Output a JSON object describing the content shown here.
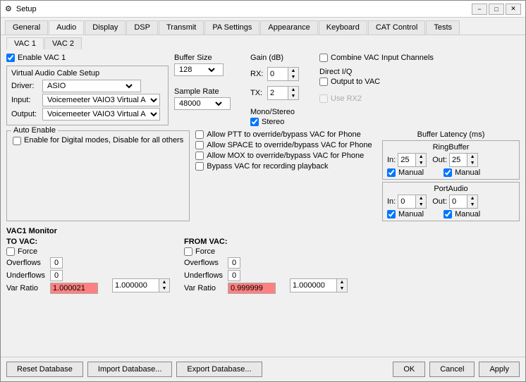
{
  "window": {
    "title": "Setup",
    "icon": "gear-icon"
  },
  "title_bar_controls": {
    "minimize": "−",
    "maximize": "□",
    "close": "✕"
  },
  "tabs_main": [
    {
      "label": "General",
      "active": false
    },
    {
      "label": "Audio",
      "active": true
    },
    {
      "label": "Display",
      "active": false
    },
    {
      "label": "DSP",
      "active": false
    },
    {
      "label": "Transmit",
      "active": false
    },
    {
      "label": "PA Settings",
      "active": false
    },
    {
      "label": "Appearance",
      "active": false
    },
    {
      "label": "Keyboard",
      "active": false
    },
    {
      "label": "CAT Control",
      "active": false
    },
    {
      "label": "Tests",
      "active": false
    }
  ],
  "sub_tabs": [
    {
      "label": "VAC 1",
      "active": true
    },
    {
      "label": "VAC 2",
      "active": false
    }
  ],
  "vac1": {
    "enable_label": "Enable VAC 1",
    "enable_checked": true,
    "virtual_audio_cable_setup_label": "Virtual Audio Cable Setup",
    "driver_label": "Driver:",
    "driver_value": "ASIO",
    "input_label": "Input:",
    "input_value": "Voicemeeter VAIO3 Virtual A",
    "output_label": "Output:",
    "output_value": "Voicemeeter VAIO3 Virtual A",
    "buffer_size_label": "Buffer Size",
    "buffer_size_value": "128",
    "sample_rate_label": "Sample Rate",
    "sample_rate_value": "48000",
    "gain_label": "Gain (dB)",
    "rx_label": "RX:",
    "rx_value": "0",
    "tx_label": "TX:",
    "tx_value": "2",
    "mono_stereo_label": "Mono/Stereo",
    "stereo_label": "Stereo",
    "stereo_checked": true,
    "combine_vac_label": "Combine VAC Input Channels",
    "combine_vac_checked": false,
    "direct_iq_label": "Direct I/Q",
    "output_to_vac_label": "Output to VAC",
    "output_to_vac_checked": false,
    "use_rx2_label": "Use RX2",
    "use_rx2_checked": false,
    "use_rx2_enabled": false,
    "auto_enable_group": "Auto Enable",
    "digital_modes_label": "Enable for Digital modes, Disable for all others",
    "digital_modes_checked": false,
    "allow_ptt_label": "Allow PTT to override/bypass VAC for Phone",
    "allow_ptt_checked": false,
    "allow_space_label": "Allow SPACE to override/bypass VAC for Phone",
    "allow_space_checked": false,
    "allow_mox_label": "Allow MOX to override/bypass VAC for Phone",
    "allow_mox_checked": false,
    "bypass_vac_label": "Bypass VAC for recording playback",
    "bypass_vac_checked": false,
    "buffer_latency_label": "Buffer Latency (ms)",
    "ring_buffer_label": "RingBuffer",
    "ring_in_label": "In:",
    "ring_in_value": "25",
    "ring_out_label": "Out:",
    "ring_out_value": "25",
    "ring_manual_in_label": "Manual",
    "ring_manual_in_checked": true,
    "ring_manual_out_label": "Manual",
    "ring_manual_out_checked": true,
    "port_audio_label": "PortAudio",
    "port_in_label": "In:",
    "port_in_value": "0",
    "port_out_label": "Out:",
    "port_out_value": "0",
    "port_manual_in_label": "Manual",
    "port_manual_in_checked": true,
    "port_manual_out_label": "Manual",
    "port_manual_out_checked": true,
    "vac1_monitor_label": "VAC1 Monitor",
    "to_vac_label": "TO VAC:",
    "force_label1": "Force",
    "force_checked1": false,
    "overflows1_label": "Overflows",
    "overflows1_value": "0",
    "underflows1_label": "Underflows",
    "underflows1_value": "0",
    "var_ratio1_label": "Var Ratio",
    "var_ratio1_value": "1.000021",
    "from_vac_label": "FROM VAC:",
    "force_label2": "Force",
    "force_checked2": false,
    "overflows2_label": "Overflows",
    "overflows2_value": "0",
    "underflows2_label": "Underflows",
    "underflows2_value": "0",
    "var_ratio2_label": "Var Ratio",
    "var_ratio2_value": "0.999999",
    "spinner1_value": "1.000000",
    "spinner2_value": "1.000000"
  },
  "bottom_buttons": {
    "reset": "Reset Database",
    "import": "Import Database...",
    "export": "Export Database...",
    "ok": "OK",
    "cancel": "Cancel",
    "apply": "Apply"
  }
}
